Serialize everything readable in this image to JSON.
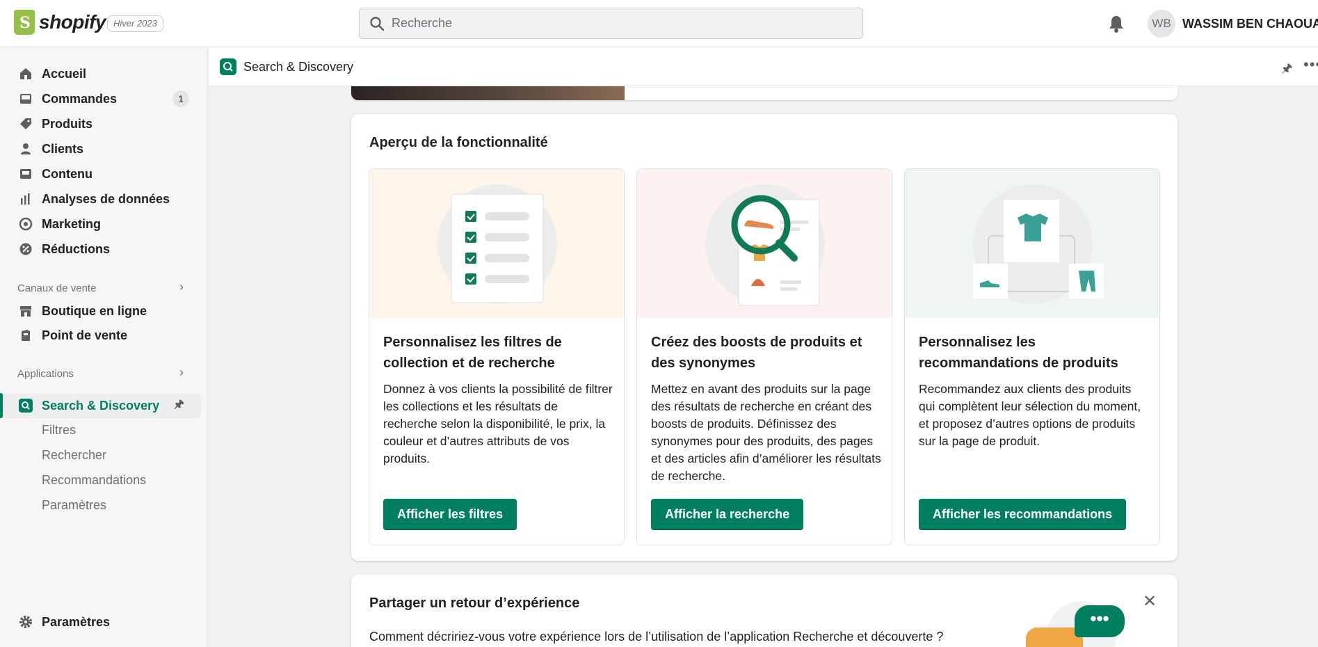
{
  "topbar": {
    "logo_text": "shopify",
    "edition_badge": "Hiver 2023",
    "search_placeholder": "Recherche",
    "avatar_initials": "WB",
    "user_name": "WASSIM BEN CHAOUA..."
  },
  "sidebar": {
    "items": [
      {
        "label": "Accueil",
        "icon": "home-icon"
      },
      {
        "label": "Commandes",
        "icon": "inbox-icon",
        "count": "1"
      },
      {
        "label": "Produits",
        "icon": "tag-icon"
      },
      {
        "label": "Clients",
        "icon": "person-icon"
      },
      {
        "label": "Contenu",
        "icon": "content-icon"
      },
      {
        "label": "Analyses de données",
        "icon": "bar-chart-icon"
      },
      {
        "label": "Marketing",
        "icon": "target-icon"
      },
      {
        "label": "Réductions",
        "icon": "discount-icon"
      }
    ],
    "sales_channels_heading": "Canaux de vente",
    "sales_channels": [
      {
        "label": "Boutique en ligne",
        "icon": "store-icon"
      },
      {
        "label": "Point de vente",
        "icon": "pos-icon"
      }
    ],
    "apps_heading": "Applications",
    "active_app": {
      "label": "Search & Discovery",
      "icon": "search-discovery-icon"
    },
    "app_subitems": [
      "Filtres",
      "Rechercher",
      "Recommandations",
      "Paramètres"
    ],
    "settings_label": "Paramètres"
  },
  "app_header": {
    "title": "Search & Discovery",
    "more": "•••"
  },
  "overview": {
    "title": "Aperçu de la fonctionnalité",
    "features": [
      {
        "title": "Personnalisez les filtres de collection et de recherche",
        "description": "Donnez à vos clients la possibilité de filtrer les collections et les résultats de recherche selon la disponibilité, le prix, la couleur et d’autres attributs de vos produits.",
        "button": "Afficher les filtres",
        "bg_color": "#fdf4ea"
      },
      {
        "title": "Créez des boosts de produits et des synonymes",
        "description": "Mettez en avant des produits sur la page des résultats de recherche en créant des boosts de produits. Définissez des synonymes pour des produits, des pages et des articles afin d’améliorer les résultats de recherche.",
        "button": "Afficher la recherche",
        "bg_color": "#fef1f1"
      },
      {
        "title": "Personnalisez les recommandations de produits",
        "description": "Recommandez aux clients des produits qui complètent leur sélection du moment, et proposez d’autres options de produits sur la page de produit.",
        "button": "Afficher les recommandations",
        "bg_color": "#eef5f2"
      }
    ]
  },
  "feedback": {
    "title": "Partager un retour d’expérience",
    "question": "Comment décririez-vous votre expérience lors de l’utilisation de l’application Recherche et découverte ?",
    "bubble_text": "•••"
  },
  "colors": {
    "primary": "#008060",
    "sidebar_bg": "#f6f6f7",
    "page_bg": "#f1f1f1"
  }
}
